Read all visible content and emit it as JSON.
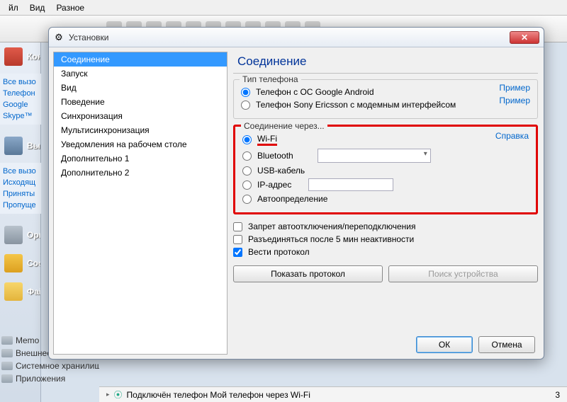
{
  "menubar": {
    "file": "йл",
    "view": "Вид",
    "misc": "Разное"
  },
  "sidebar": {
    "items": [
      {
        "label": "Кон"
      },
      {
        "label": "Выз"
      },
      {
        "label": "Орг"
      },
      {
        "label": "Соо"
      },
      {
        "label": "Фай"
      }
    ],
    "links_block1": [
      "Все вызо",
      "Телефон",
      "Google",
      "Skype™"
    ],
    "links_block2": [
      "Все вызо",
      "Исходящ",
      "Приняты",
      "Пропуще"
    ],
    "bottom_items": [
      "Memo",
      "Внешнее хранилище",
      "Системное хранилище",
      "Приложения"
    ]
  },
  "dialog": {
    "title": "Установки",
    "categories": [
      "Соединение",
      "Запуск",
      "Вид",
      "Поведение",
      "Синхронизация",
      "Мультисинхронизация",
      "Уведомления на рабочем столе",
      "Дополнительно 1",
      "Дополнительно 2"
    ],
    "selected_category": "Соединение",
    "panel_head": "Соединение",
    "phone_type": {
      "title": "Тип телефона",
      "opt1": "Телефон с ОС Google Android",
      "opt2": "Телефон Sony Ericsson с модемным интерфейсом",
      "example": "Пример"
    },
    "conn_via": {
      "title": "Соединение через...",
      "help": "Справка",
      "opts": {
        "wifi": "Wi-Fi",
        "bt": "Bluetooth",
        "usb": "USB-кабель",
        "ip": "IP-адрес",
        "auto": "Автоопределение"
      }
    },
    "checks": {
      "c1": "Запрет автоотключения/переподключения",
      "c2": "Разъединяться после 5 мин неактивности",
      "c3": "Вести протокол"
    },
    "buttons": {
      "show_log": "Показать протокол",
      "search": "Поиск устройства",
      "ok": "ОК",
      "cancel": "Отмена"
    }
  },
  "statusbar": {
    "text": "Подключён телефон Мой телефон через Wi-Fi",
    "badge": "3"
  }
}
